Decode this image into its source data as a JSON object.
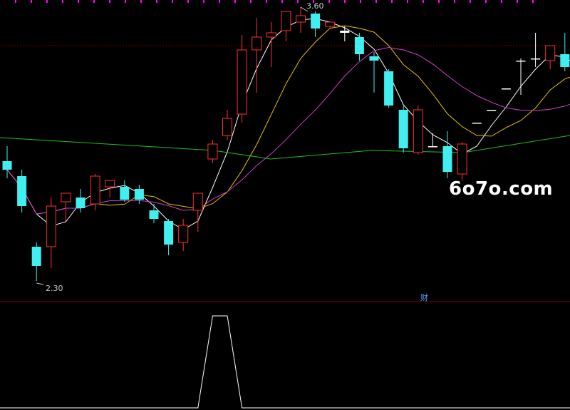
{
  "chart_data": {
    "type": "candlestick",
    "price_range": [
      2.3,
      3.6
    ],
    "high_label": "3.60",
    "low_label": "2.30",
    "candles": [
      {
        "o": 2.88,
        "h": 2.95,
        "l": 2.8,
        "c": 2.84,
        "dir": "down"
      },
      {
        "o": 2.81,
        "h": 2.84,
        "l": 2.64,
        "c": 2.67,
        "dir": "down"
      },
      {
        "o": 2.48,
        "h": 2.5,
        "l": 2.32,
        "c": 2.39,
        "dir": "down"
      },
      {
        "o": 2.48,
        "h": 2.71,
        "l": 2.38,
        "c": 2.67,
        "dir": "up"
      },
      {
        "o": 2.69,
        "h": 2.73,
        "l": 2.6,
        "c": 2.73,
        "dir": "up"
      },
      {
        "o": 2.71,
        "h": 2.75,
        "l": 2.64,
        "c": 2.66,
        "dir": "down"
      },
      {
        "o": 2.68,
        "h": 2.82,
        "l": 2.65,
        "c": 2.81,
        "dir": "up"
      },
      {
        "o": 2.76,
        "h": 2.79,
        "l": 2.71,
        "c": 2.79,
        "dir": "up"
      },
      {
        "o": 2.76,
        "h": 2.79,
        "l": 2.69,
        "c": 2.7,
        "dir": "down"
      },
      {
        "o": 2.75,
        "h": 2.77,
        "l": 2.68,
        "c": 2.7,
        "dir": "down"
      },
      {
        "o": 2.65,
        "h": 2.68,
        "l": 2.59,
        "c": 2.61,
        "dir": "down"
      },
      {
        "o": 2.6,
        "h": 2.61,
        "l": 2.44,
        "c": 2.49,
        "dir": "down"
      },
      {
        "o": 2.5,
        "h": 2.61,
        "l": 2.46,
        "c": 2.58,
        "dir": "up"
      },
      {
        "o": 2.65,
        "h": 2.68,
        "l": 2.55,
        "c": 2.73,
        "dir": "up"
      },
      {
        "o": 2.89,
        "h": 2.98,
        "l": 2.87,
        "c": 2.96,
        "dir": "up"
      },
      {
        "o": 3.0,
        "h": 3.12,
        "l": 2.98,
        "c": 3.08,
        "dir": "up"
      },
      {
        "o": 3.1,
        "h": 3.47,
        "l": 3.06,
        "c": 3.4,
        "dir": "up"
      },
      {
        "o": 3.4,
        "h": 3.55,
        "l": 3.2,
        "c": 3.46,
        "dir": "up"
      },
      {
        "o": 3.46,
        "h": 3.53,
        "l": 3.32,
        "c": 3.48,
        "dir": "up"
      },
      {
        "o": 3.49,
        "h": 3.56,
        "l": 3.44,
        "c": 3.58,
        "dir": "up"
      },
      {
        "o": 3.53,
        "h": 3.6,
        "l": 3.48,
        "c": 3.56,
        "dir": "up"
      },
      {
        "o": 3.57,
        "h": 3.58,
        "l": 3.46,
        "c": 3.5,
        "dir": "down"
      },
      {
        "o": 3.51,
        "h": 3.53,
        "l": 3.5,
        "c": 3.53,
        "dir": "up"
      },
      {
        "o": 3.49,
        "h": 3.51,
        "l": 3.44,
        "c": 3.48,
        "dir": "flat"
      },
      {
        "o": 3.46,
        "h": 3.48,
        "l": 3.35,
        "c": 3.38,
        "dir": "down"
      },
      {
        "o": 3.37,
        "h": 3.39,
        "l": 3.2,
        "c": 3.35,
        "dir": "down"
      },
      {
        "o": 3.3,
        "h": 3.31,
        "l": 3.13,
        "c": 3.14,
        "dir": "down"
      },
      {
        "o": 3.12,
        "h": 3.14,
        "l": 2.92,
        "c": 2.94,
        "dir": "down"
      },
      {
        "o": 2.92,
        "h": 3.14,
        "l": 2.91,
        "c": 3.12,
        "dir": "up"
      },
      {
        "o": 2.95,
        "h": 3.01,
        "l": 2.95,
        "c": 2.95,
        "dir": "flat"
      },
      {
        "o": 2.95,
        "h": 3.02,
        "l": 2.8,
        "c": 2.83,
        "dir": "down"
      },
      {
        "o": 2.82,
        "h": 2.97,
        "l": 2.79,
        "c": 2.96,
        "dir": "up"
      },
      {
        "o": 3.06,
        "h": 3.06,
        "l": 3.06,
        "c": 3.06,
        "dir": "flat"
      },
      {
        "o": 3.12,
        "h": 3.12,
        "l": 3.12,
        "c": 3.12,
        "dir": "flat"
      },
      {
        "o": 3.22,
        "h": 3.22,
        "l": 3.22,
        "c": 3.22,
        "dir": "flat"
      },
      {
        "o": 3.35,
        "h": 3.36,
        "l": 3.19,
        "c": 3.35,
        "dir": "flat"
      },
      {
        "o": 3.36,
        "h": 3.48,
        "l": 3.32,
        "c": 3.36,
        "dir": "flat"
      },
      {
        "o": 3.35,
        "h": 3.42,
        "l": 3.31,
        "c": 3.42,
        "dir": "up"
      },
      {
        "o": 3.38,
        "h": 3.48,
        "l": 3.3,
        "c": 3.32,
        "dir": "down"
      },
      {
        "o": 3.24,
        "h": 3.27,
        "l": 3.19,
        "c": 3.22,
        "dir": "up"
      }
    ],
    "ma_lines": [
      {
        "name": "MA5",
        "color": "#ffffff"
      },
      {
        "name": "MA10",
        "color": "#e8c000"
      },
      {
        "name": "MA20",
        "color": "#d040d0"
      },
      {
        "name": "MA60",
        "color": "#20c020"
      }
    ],
    "indicator": {
      "values": [
        0,
        0,
        0,
        0,
        0,
        0,
        0,
        0,
        0,
        0,
        0,
        0,
        0,
        0,
        1,
        1,
        0,
        0,
        0,
        0,
        0,
        0,
        0,
        0,
        0,
        0,
        0,
        0,
        0,
        0,
        0,
        0,
        0,
        0,
        0,
        0,
        0,
        0,
        0,
        0
      ],
      "color": "#ffffff"
    }
  },
  "watermark": "6o7o.com",
  "finance_badge": "财",
  "colors": {
    "up": "#ff3030",
    "down": "#40f0f0",
    "background": "#000000",
    "divider": "#800000",
    "top_marks": "#ff00ff"
  }
}
